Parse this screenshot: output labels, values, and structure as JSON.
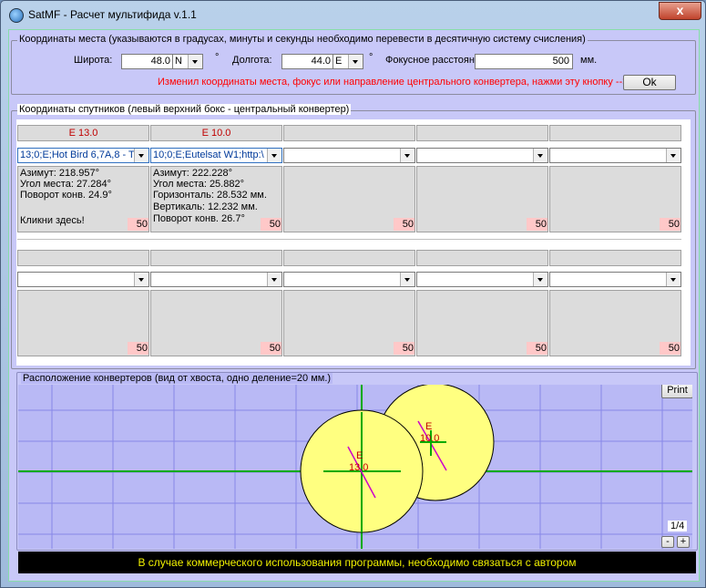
{
  "window": {
    "title": "SatMF - Расчет мультифида v.1.1",
    "close_label": "x"
  },
  "location": {
    "group_title": "Координаты места (указываются в градусах, минуты  и секунды необходимо перевести в десятичную систему счисления)",
    "lat_label": "Широта:",
    "lat_value": "48.0",
    "lat_hemisphere": "N",
    "degree_mark": "°",
    "lon_label": "Долгота:",
    "lon_value": "44.0",
    "lon_hemisphere": "E",
    "focal_label": "Фокусное расстояние:",
    "focal_value": "500",
    "focal_unit": "мм.",
    "hint": "Изменил координаты места, фокус или направление центрального конвертера, нажми эту кнопку -->",
    "ok_label": "Ok",
    "hint_color": "#ff0000"
  },
  "satellites": {
    "group_title": "Координаты спутников (левый верхний бокс - центральный конвертер)",
    "row1": {
      "headers": [
        "E 13.0",
        "E 10.0",
        "",
        "",
        ""
      ],
      "combos": [
        "13;0;E;Hot Bird 6,7A,8 - T",
        "10;0;E;Eutelsat W1;http:\\",
        "",
        "",
        ""
      ],
      "info": [
        {
          "lines": [
            "Азимут:  218.957°",
            "Угол места:  27.284°",
            "Поворот конв. 24.9°",
            "",
            "Кликни здесь!"
          ],
          "focus": "50"
        },
        {
          "lines": [
            "Азимут:  222.228°",
            "Угол места:  25.882°",
            "Горизонталь:  28.532 мм.",
            "Вертикаль:  12.232 мм.",
            "Поворот конв. 26.7°"
          ],
          "focus": "50"
        },
        {
          "lines": [],
          "focus": "50"
        },
        {
          "lines": [],
          "focus": "50"
        },
        {
          "lines": [],
          "focus": "50"
        }
      ]
    },
    "row2": {
      "headers": [
        "",
        "",
        "",
        "",
        ""
      ],
      "combos": [
        "",
        "",
        "",
        "",
        ""
      ],
      "info": [
        {
          "focus": "50"
        },
        {
          "focus": "50"
        },
        {
          "focus": "50"
        },
        {
          "focus": "50"
        },
        {
          "focus": "50"
        }
      ]
    },
    "header_text_color": "#c00000"
  },
  "layout_view": {
    "group_title": "Расположение конвертеров (вид от хвоста, одно деление=20 мм.)",
    "print_label": "Print",
    "zoom_label": "1/4",
    "zoom_minus": "-",
    "zoom_plus": "+",
    "converters": [
      {
        "label_top": "E",
        "label_bottom": "13.0"
      },
      {
        "label_top": "E",
        "label_bottom": "10.0"
      }
    ],
    "colors": {
      "background": "#b9b9f5",
      "grid": "#8888e8",
      "axes": "#00aa00",
      "converter_fill": "#ffff80",
      "converter_mark": "#cc00cc",
      "label": "#c00000"
    }
  },
  "status": {
    "text": "В случае коммерческого использования программы, необходимо связаться с автором"
  }
}
